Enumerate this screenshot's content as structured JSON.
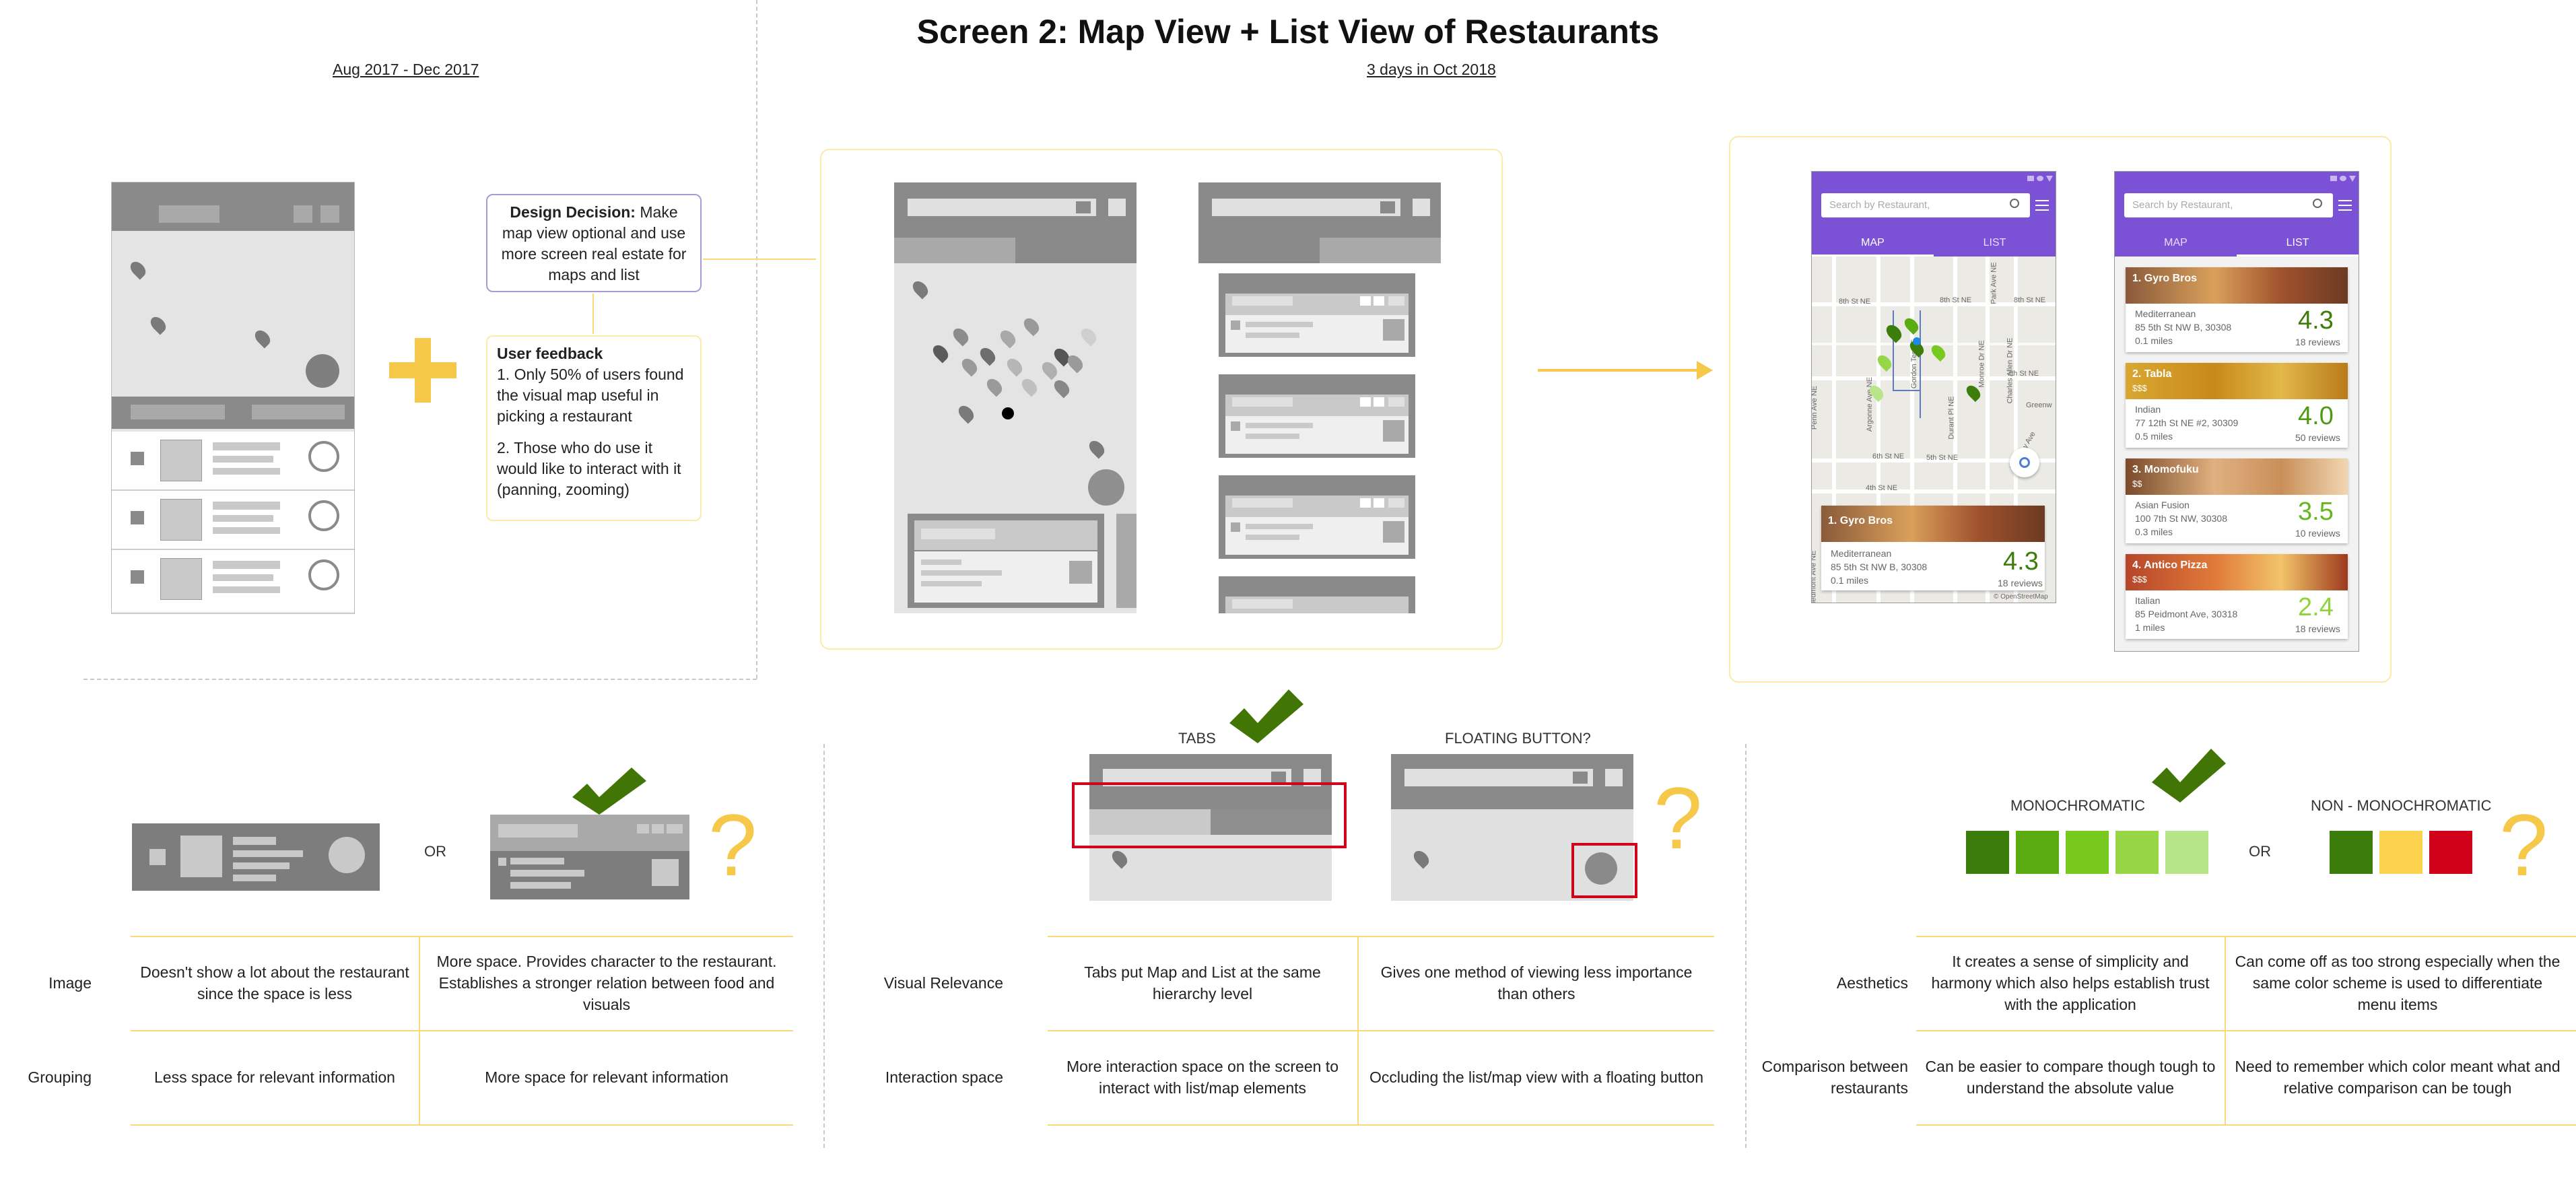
{
  "title": "Screen 2: Map View + List View of Restaurants",
  "periods": {
    "left": "Aug 2017 - Dec 2017",
    "right": "3 days in Oct 2018"
  },
  "design_decision": {
    "label": "Design Decision:",
    "text": "Make map view optional and use more screen real estate for maps and list"
  },
  "user_feedback": {
    "title": "User feedback",
    "item1": "1. Only 50% of users found the visual map useful in picking a restaurant",
    "item2": "2. Those who do use it would like to interact with it (panning, zooming)"
  },
  "final_ui": {
    "search_placeholder": "Search by Restaurant,",
    "tab_map": "MAP",
    "tab_list": "LIST",
    "streets": [
      "8th St NE",
      "7th St NE",
      "6th St NE",
      "5th St NE",
      "4th St NE",
      "Piedmont Ave NE",
      "Argonne Ave NE",
      "Penn Ave NE",
      "Durant Pl NE",
      "Myrtle St NE",
      "Charles Allen Dr NE",
      "Park Ave NE",
      "Greenw",
      "Gordon Ter NE",
      "Monroe Dr NE",
      "Parkway Ave NE"
    ],
    "map_attribution": "© OpenStreetMap",
    "map_card": {
      "name": "1. Gyro Bros",
      "cuisine": "Mediterranean",
      "address": "85 5th St NW B, 30308",
      "distance": "0.1 miles",
      "rating": "4.3",
      "reviews": "18 reviews"
    },
    "restaurants": [
      {
        "name": "1. Gyro Bros",
        "price": "",
        "cuisine": "Mediterranean",
        "address": "85 5th St NW B, 30308",
        "distance": "0.1 miles",
        "rating": "4.3",
        "reviews": "18 reviews",
        "rating_color": "#3c7d0c"
      },
      {
        "name": "2. Tabla",
        "price": "$$$",
        "cuisine": "Indian",
        "address": "77 12th St NE #2, 30309",
        "distance": "0.5 miles",
        "rating": "4.0",
        "reviews": "50 reviews",
        "rating_color": "#4f9a13"
      },
      {
        "name": "3. Momofuku",
        "price": "$$",
        "cuisine": "Asian Fusion",
        "address": "100 7th St NW, 30308",
        "distance": "0.3 miles",
        "rating": "3.5",
        "reviews": "10 reviews",
        "rating_color": "#62b81c"
      },
      {
        "name": "4. Antico Pizza",
        "price": "$$$",
        "cuisine": "Italian",
        "address": "85 Peidmont Ave, 30318",
        "distance": "1 miles",
        "rating": "2.4",
        "reviews": "18 reviews",
        "rating_color": "#8ed43a"
      }
    ]
  },
  "comparisons": {
    "left": {
      "or": "OR"
    },
    "middle": {
      "tabs_label": "TABS",
      "floating_label": "FLOATING BUTTON?"
    },
    "right": {
      "mono_label": "MONOCHROMATIC",
      "nonmono_label": "NON - MONOCHROMATIC",
      "or": "OR"
    }
  },
  "mono_colors": [
    "#3c7d0c",
    "#5aac12",
    "#78c91f",
    "#97d646",
    "#b8e48a"
  ],
  "nonmono_colors": [
    "#3c7d0c",
    "#fbd34d",
    "#d0021b"
  ],
  "accent_colors": {
    "yellow": "#f5c84a",
    "green_check": "#417505",
    "purple": "#7b52d6",
    "red_outline": "#d0021b"
  },
  "tables": {
    "left": {
      "rows": [
        {
          "label": "Image",
          "a": "Doesn't show a lot about the restaurant since the space is less",
          "b": "More space. Provides character to the restaurant. Establishes a stronger relation between food and visuals"
        },
        {
          "label": "Grouping",
          "a": "Less space for relevant information",
          "b": "More space for relevant information"
        }
      ]
    },
    "middle": {
      "rows": [
        {
          "label": "Visual Relevance",
          "a": "Tabs put Map and List at the same hierarchy level",
          "b": "Gives one method of viewing less importance than others"
        },
        {
          "label": "Interaction space",
          "a": "More interaction space on the screen to interact with list/map elements",
          "b": "Occluding the list/map view with a floating button"
        }
      ]
    },
    "right": {
      "rows": [
        {
          "label": "Aesthetics",
          "a": "It creates a sense of simplicity and harmony which also helps establish trust with the application",
          "b": "Can come off as too strong especially when the same color scheme is used to differentiate menu items"
        },
        {
          "label": "Comparison between restaurants",
          "a": "Can be easier to compare though tough to understand the absolute value",
          "b": "Need to remember which color meant what and relative comparison can be tough"
        }
      ]
    }
  }
}
